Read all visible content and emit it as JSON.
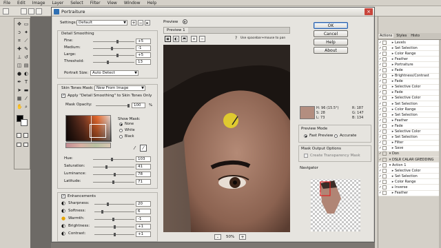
{
  "menubar": [
    "File",
    "Edit",
    "Image",
    "Layer",
    "Select",
    "Filter",
    "View",
    "Window",
    "Help"
  ],
  "dialog": {
    "title": "Portraiture",
    "settings_label": "Settings:",
    "settings_value": "Default",
    "detail_smoothing": {
      "header": "Detail Smoothing",
      "rows": [
        {
          "label": "Fine:",
          "value": "+5"
        },
        {
          "label": "Medium:",
          "value": "-1"
        },
        {
          "label": "Large:",
          "value": "+5"
        },
        {
          "label": "Threshold:",
          "value": "13"
        }
      ],
      "portrait_size_label": "Portrait Size:",
      "portrait_size_value": "Auto Detect"
    },
    "skin_tones": {
      "mask_label": "Skin Tones Mask:",
      "mask_value": "New From Image",
      "apply_label": "Apply \"Detail Smoothing\" to Skin Tones Only",
      "opacity_label": "Mask Opacity:",
      "opacity_value": "100",
      "opacity_unit": "%",
      "show_mask_label": "Show Mask:",
      "show_mask_options": [
        "None",
        "White",
        "Black"
      ],
      "rows": [
        {
          "label": "Hue:",
          "value": "103"
        },
        {
          "label": "Saturation:",
          "value": "41"
        },
        {
          "label": "Luminance:",
          "value": "78"
        },
        {
          "label": "Latitude:",
          "value": "71"
        }
      ]
    },
    "enhancements": {
      "header": "Enhancements",
      "rows": [
        {
          "label": "Sharpness:",
          "value": "20",
          "icon": "circle-half-icon"
        },
        {
          "label": "Softness:",
          "value": "6",
          "icon": "circle-half-icon"
        },
        {
          "label": "Warmth:",
          "value": "-1",
          "icon": "sun-icon"
        },
        {
          "label": "Brightness:",
          "value": "+1",
          "icon": "circle-half-icon"
        },
        {
          "label": "Contrast:",
          "value": "+1",
          "icon": "circle-half-icon"
        }
      ]
    },
    "preview": {
      "label": "Preview",
      "tab": "Preview 1",
      "hint": "Use spacebar+mouse to pan",
      "zoom": "50%",
      "zoom_minus": "-",
      "zoom_plus": "+"
    },
    "buttons": {
      "ok": "OK",
      "cancel": "Cancel",
      "help": "Help",
      "about": "About"
    },
    "info": {
      "h": "H: 96 (15.5°)",
      "s": "S: 28",
      "l": "L: 73",
      "r": "R: 187",
      "g": "G: 147",
      "b": "B: 134",
      "swatch_color": "#b38e80"
    },
    "preview_mode": {
      "label": "Preview Mode",
      "options": [
        "Fast Preview",
        "Accurate"
      ],
      "selected": "Fast Preview"
    },
    "mask_output": {
      "label": "Mask Output Options",
      "checkbox": "Create Transparency Mask"
    },
    "navigator": {
      "label": "Navigator"
    }
  },
  "actions_panel": {
    "tabs": [
      "Actions",
      "Styles",
      "Histo"
    ],
    "items": [
      "Levels",
      "Set Selection",
      "Color Range",
      "Feather",
      "Portraiture",
      "Fade",
      "Brightness/Contrast",
      "Fade",
      "Selective Color",
      "Fade",
      "Selective Color",
      "Set Selection",
      "Color Range",
      "Set Selection",
      "Feather",
      "Fade",
      "Selective Color",
      "Set Selection",
      "Filter",
      "Save"
    ],
    "set_1": "Don",
    "set_2": "DSLR CALAR GREDDING",
    "action_1": "Action 1",
    "items_2": [
      "Selective Color",
      "Set Selection",
      "Color Range",
      "Inverse",
      "Feather"
    ]
  }
}
